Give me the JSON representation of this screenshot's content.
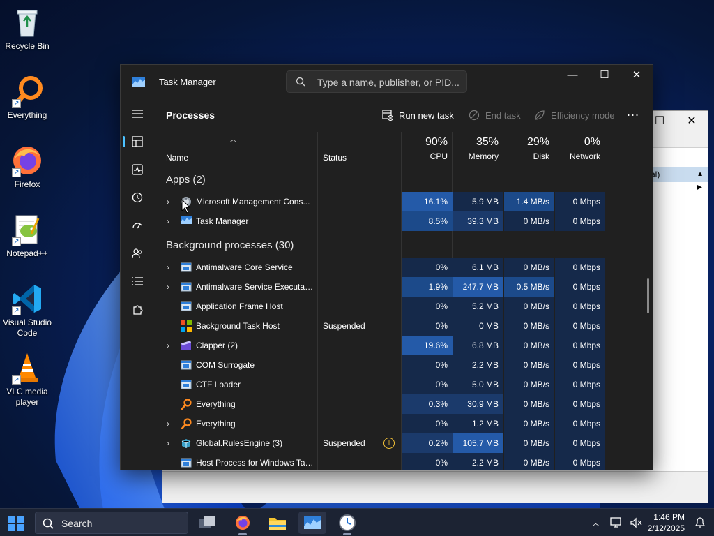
{
  "desktop": {
    "icons": [
      {
        "label": "Recycle Bin",
        "icon": "recycle-bin-icon"
      },
      {
        "label": "Everything",
        "icon": "everything-search-icon"
      },
      {
        "label": "Firefox",
        "icon": "firefox-icon"
      },
      {
        "label": "Notepad++",
        "icon": "notepad-plus-plus-icon"
      },
      {
        "label": "Visual Studio Code",
        "icon": "vscode-icon"
      },
      {
        "label": "VLC media player",
        "icon": "vlc-icon"
      }
    ]
  },
  "background_window": {
    "actions_header": "cal)"
  },
  "task_manager": {
    "title": "Task Manager",
    "search_placeholder": "Type a name, publisher, or PID...",
    "page_title": "Processes",
    "toolbar": {
      "run_new_task": "Run new task",
      "end_task": "End task",
      "efficiency_mode": "Efficiency mode",
      "more": "..."
    },
    "columns": {
      "name": "Name",
      "status": "Status",
      "cpu": {
        "pct": "90%",
        "label": "CPU"
      },
      "memory": {
        "pct": "35%",
        "label": "Memory"
      },
      "disk": {
        "pct": "29%",
        "label": "Disk"
      },
      "network": {
        "pct": "0%",
        "label": "Network"
      }
    },
    "groups": {
      "apps": "Apps (2)",
      "background": "Background processes (30)"
    },
    "apps": [
      {
        "name": "Microsoft Management Cons...",
        "expandable": true,
        "icon": "mmc-icon",
        "status": "",
        "cpu": "16.1%",
        "memory": "5.9 MB",
        "disk": "1.4 MB/s",
        "network": "0 Mbps"
      },
      {
        "name": "Task Manager",
        "expandable": true,
        "icon": "task-manager-icon",
        "status": "",
        "cpu": "8.5%",
        "memory": "39.3 MB",
        "disk": "0 MB/s",
        "network": "0 Mbps"
      }
    ],
    "background": [
      {
        "name": "Antimalware Core Service",
        "expandable": true,
        "icon": "service-window-icon",
        "status": "",
        "cpu": "0%",
        "memory": "6.1 MB",
        "disk": "0 MB/s",
        "network": "0 Mbps"
      },
      {
        "name": "Antimalware Service Executable",
        "expandable": true,
        "icon": "service-window-icon",
        "status": "",
        "cpu": "1.9%",
        "memory": "247.7 MB",
        "disk": "0.5 MB/s",
        "network": "0 Mbps"
      },
      {
        "name": "Application Frame Host",
        "expandable": false,
        "icon": "service-window-icon",
        "status": "",
        "cpu": "0%",
        "memory": "5.2 MB",
        "disk": "0 MB/s",
        "network": "0 Mbps"
      },
      {
        "name": "Background Task Host",
        "expandable": false,
        "icon": "windows-logo-icon",
        "status": "Suspended",
        "cpu": "0%",
        "memory": "0 MB",
        "disk": "0 MB/s",
        "network": "0 Mbps"
      },
      {
        "name": "Clapper (2)",
        "expandable": true,
        "icon": "clapper-icon",
        "status": "",
        "cpu": "19.6%",
        "memory": "6.8 MB",
        "disk": "0 MB/s",
        "network": "0 Mbps"
      },
      {
        "name": "COM Surrogate",
        "expandable": false,
        "icon": "service-window-icon",
        "status": "",
        "cpu": "0%",
        "memory": "2.2 MB",
        "disk": "0 MB/s",
        "network": "0 Mbps"
      },
      {
        "name": "CTF Loader",
        "expandable": false,
        "icon": "service-window-icon",
        "status": "",
        "cpu": "0%",
        "memory": "5.0 MB",
        "disk": "0 MB/s",
        "network": "0 Mbps"
      },
      {
        "name": "Everything",
        "expandable": false,
        "icon": "everything-search-icon",
        "status": "",
        "cpu": "0.3%",
        "memory": "30.9 MB",
        "disk": "0 MB/s",
        "network": "0 Mbps"
      },
      {
        "name": "Everything",
        "expandable": true,
        "icon": "everything-search-icon",
        "status": "",
        "cpu": "0%",
        "memory": "1.2 MB",
        "disk": "0 MB/s",
        "network": "0 Mbps"
      },
      {
        "name": "Global.RulesEngine (3)",
        "expandable": true,
        "icon": "package-icon",
        "status": "Suspended",
        "efficiency": true,
        "cpu": "0.2%",
        "memory": "105.7 MB",
        "disk": "0 MB/s",
        "network": "0 Mbps"
      },
      {
        "name": "Host Process for Windows Tasks",
        "expandable": false,
        "icon": "service-window-icon",
        "status": "",
        "cpu": "0%",
        "memory": "2.2 MB",
        "disk": "0 MB/s",
        "network": "0 Mbps"
      }
    ]
  },
  "taskbar": {
    "search_label": "Search",
    "apps": [
      "task-view-icon",
      "firefox-icon",
      "file-explorer-icon",
      "task-manager-icon",
      "clock-app-icon"
    ],
    "time": "1:46 PM",
    "date": "2/12/2025"
  }
}
